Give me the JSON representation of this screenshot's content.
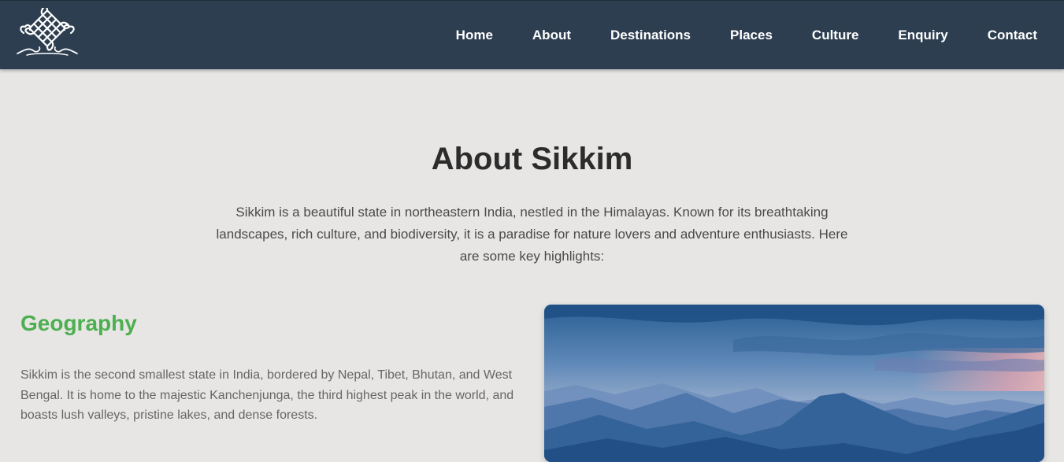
{
  "nav": {
    "logo_icon": "endless-knot-icon",
    "items": [
      {
        "label": "Home"
      },
      {
        "label": "About"
      },
      {
        "label": "Destinations"
      },
      {
        "label": "Places"
      },
      {
        "label": "Culture"
      },
      {
        "label": "Enquiry"
      },
      {
        "label": "Contact"
      }
    ]
  },
  "main": {
    "title": "About Sikkim",
    "intro": "Sikkim is a beautiful state in northeastern India, nestled in the Himalayas. Known for its breathtaking landscapes, rich culture, and biodiversity, it is a paradise for nature lovers and adventure enthusiasts. Here are some key highlights:"
  },
  "geography": {
    "heading": "Geography",
    "text": "Sikkim is the second smallest state in India, bordered by Nepal, Tibet, Bhutan, and West Bengal. It is home to the majestic Kanchenjunga, the third highest peak in the world, and boasts lush valleys, pristine lakes, and dense forests."
  },
  "colors": {
    "navbar_bg": "#2d3e50",
    "page_bg": "#e7e6e4",
    "heading_accent": "#4caf50",
    "nav_text": "#ffffff"
  }
}
